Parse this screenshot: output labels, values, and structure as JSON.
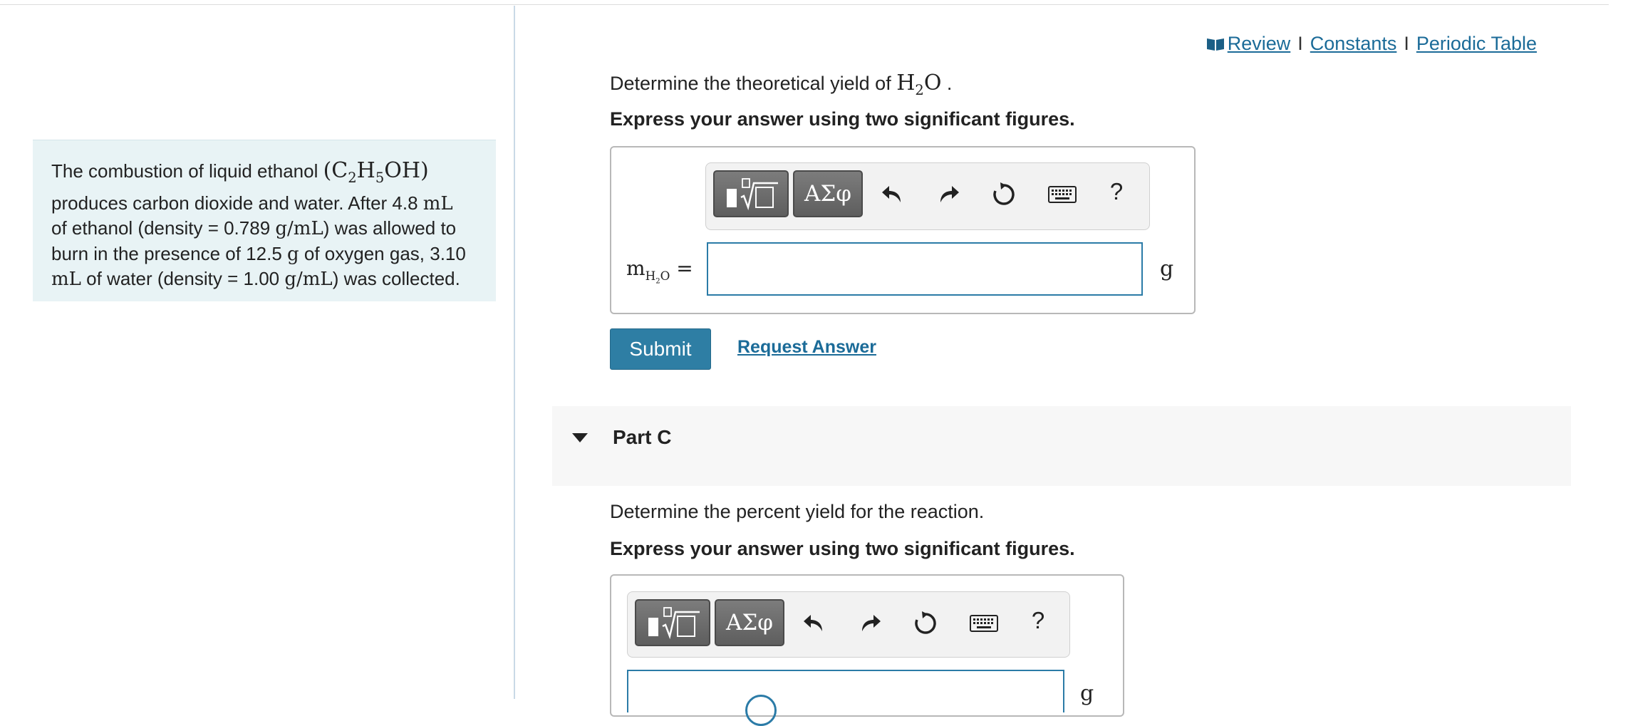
{
  "context": {
    "line1_pre": "The combustion of liquid ethanol ",
    "line1_formula": "(C",
    "line1_sub1": "2",
    "line1_mid": "H",
    "line1_sub2": "5",
    "line1_end": "OH)",
    "line2_pre": "produces carbon dioxide and water. After 4.8 ",
    "line2_unit": "mL",
    "line3_pre": "of ethanol (density = 0.789 ",
    "line3_unit": "g/mL",
    "line3_post": ") was allowed to",
    "line4_pre": "burn in the presence of 12.5 ",
    "line4_unit": "g",
    "line4_post": " of oxygen gas, 3.10",
    "line5_unit": "mL",
    "line5_mid": " of water (density = 1.00 ",
    "line5_unit2": "g/mL",
    "line5_post": ") was collected."
  },
  "links": {
    "review": "Review",
    "constants": "Constants",
    "periodic": "Periodic Table",
    "sep": "I"
  },
  "partB": {
    "question_pre": "Determine the theoretical yield of ",
    "question_H": "H",
    "question_sub": "2",
    "question_O": "O",
    "question_post": " .",
    "instruction": "Express your answer using two significant figures.",
    "label_m": "m",
    "label_sub": "H",
    "label_sub2": "2",
    "label_subO": "O",
    "label_eq": " =",
    "unit": "g",
    "input_value": "",
    "greek": "ΑΣφ",
    "help": "?"
  },
  "actions": {
    "submit": "Submit",
    "request": "Request Answer"
  },
  "partC": {
    "title": "Part C",
    "question": "Determine the percent yield for the reaction.",
    "instruction": "Express your answer using two significant figures.",
    "greek": "ΑΣφ",
    "help": "?",
    "unit": "g"
  }
}
